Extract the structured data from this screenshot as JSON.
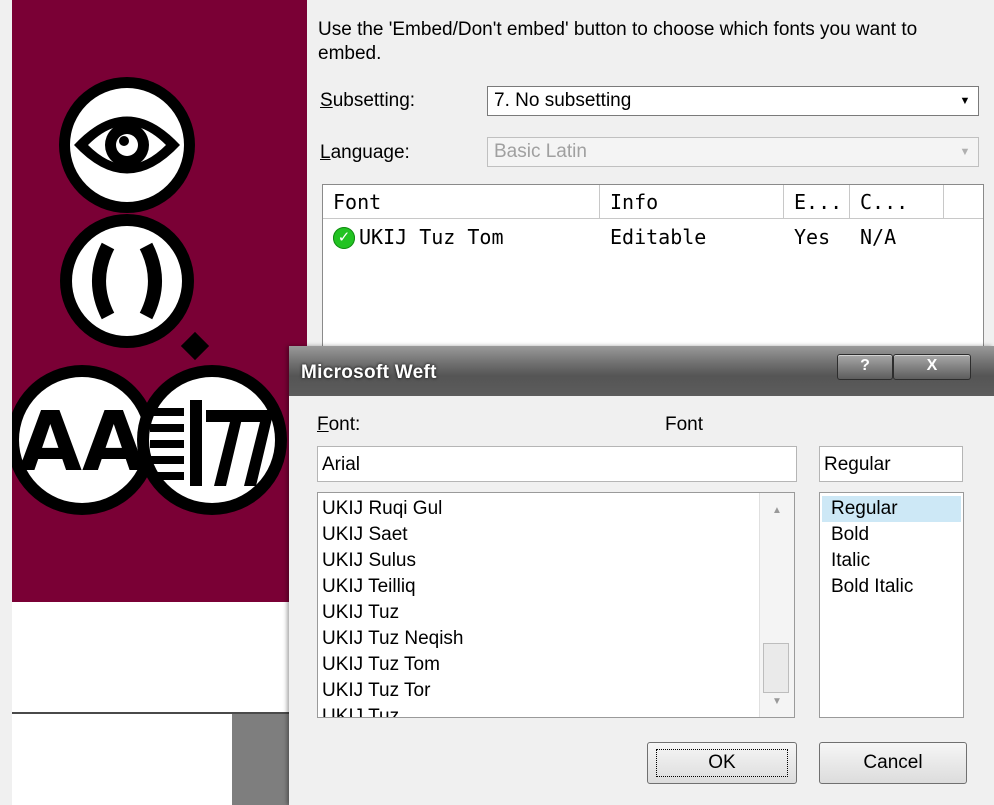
{
  "embed_pane": {
    "instructions": "Use the 'Embed/Don't embed' button to choose which fonts you want to embed.",
    "subsetting_label_first": "S",
    "subsetting_label_rest": "ubsetting:",
    "subsetting_value": "7. No subsetting",
    "language_label_first": "L",
    "language_label_rest": "anguage:",
    "language_value": "Basic Latin",
    "columns": [
      "Font",
      "Info",
      "E...",
      "C..."
    ],
    "rows": [
      {
        "font": "UKIJ Tuz Tom",
        "info": "Editable",
        "embed": "Yes",
        "cost": "N/A",
        "status_icon": "check-icon"
      }
    ]
  },
  "dialog": {
    "title": "Microsoft Weft",
    "help_label": "?",
    "close_label": "X",
    "font_label_first": "F",
    "font_label_rest": "ont:",
    "font_preview": "Font",
    "font_value": "Arial",
    "style_value": "Regular",
    "font_list": [
      "UKIJ Ruqi Gul",
      "UKIJ Saet",
      "UKIJ Sulus",
      "UKIJ Teilliq",
      "UKIJ Tuz",
      "UKIJ Tuz Neqish",
      "UKIJ Tuz Tom",
      "UKIJ Tuz Tor",
      "UKIJ Tuz ..."
    ],
    "style_list": [
      "Regular",
      "Bold",
      "Italic",
      "Bold Italic"
    ],
    "selected_style": "Regular",
    "ok_label": "OK",
    "cancel_label": "Cancel"
  },
  "colors": {
    "logo_background": "#7a0035",
    "selection": "#cde8f6",
    "status_green": "#22c322"
  }
}
